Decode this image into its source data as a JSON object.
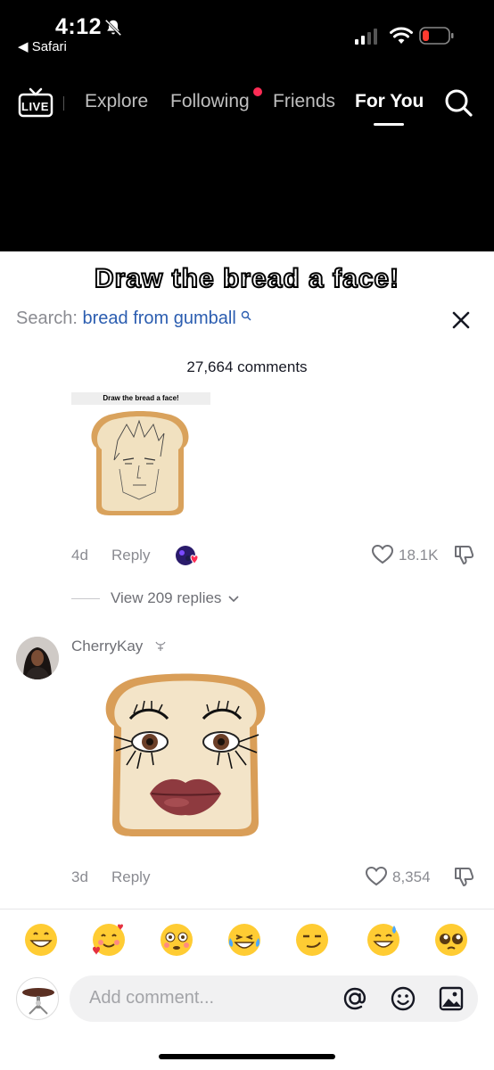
{
  "status_bar": {
    "time": "4:12",
    "back_app": "◀ Safari"
  },
  "top_nav": {
    "live_label": "LIVE",
    "tabs": [
      {
        "label": "Explore"
      },
      {
        "label": "Following"
      },
      {
        "label": "Friends"
      },
      {
        "label": "For You"
      }
    ],
    "active_tab": "For You",
    "accent_color": "#fe2c55"
  },
  "comment_sheet": {
    "video_caption": "Draw the bread a face!",
    "search_prefix": "Search: ",
    "search_query": "bread from gumball",
    "comment_count": "27,664 comments",
    "comments": [
      {
        "image_caption": "Draw the bread a face!",
        "time": "4d",
        "reply_label": "Reply",
        "like_count": "18.1K",
        "view_replies": "View 209 replies"
      },
      {
        "username": "CherryKay",
        "time": "3d",
        "reply_label": "Reply",
        "like_count": "8,354"
      }
    ],
    "emojis": [
      "😁",
      "🥰",
      "😳",
      "😂",
      "😏",
      "😅",
      "🥺"
    ],
    "input_placeholder": "Add comment..."
  }
}
